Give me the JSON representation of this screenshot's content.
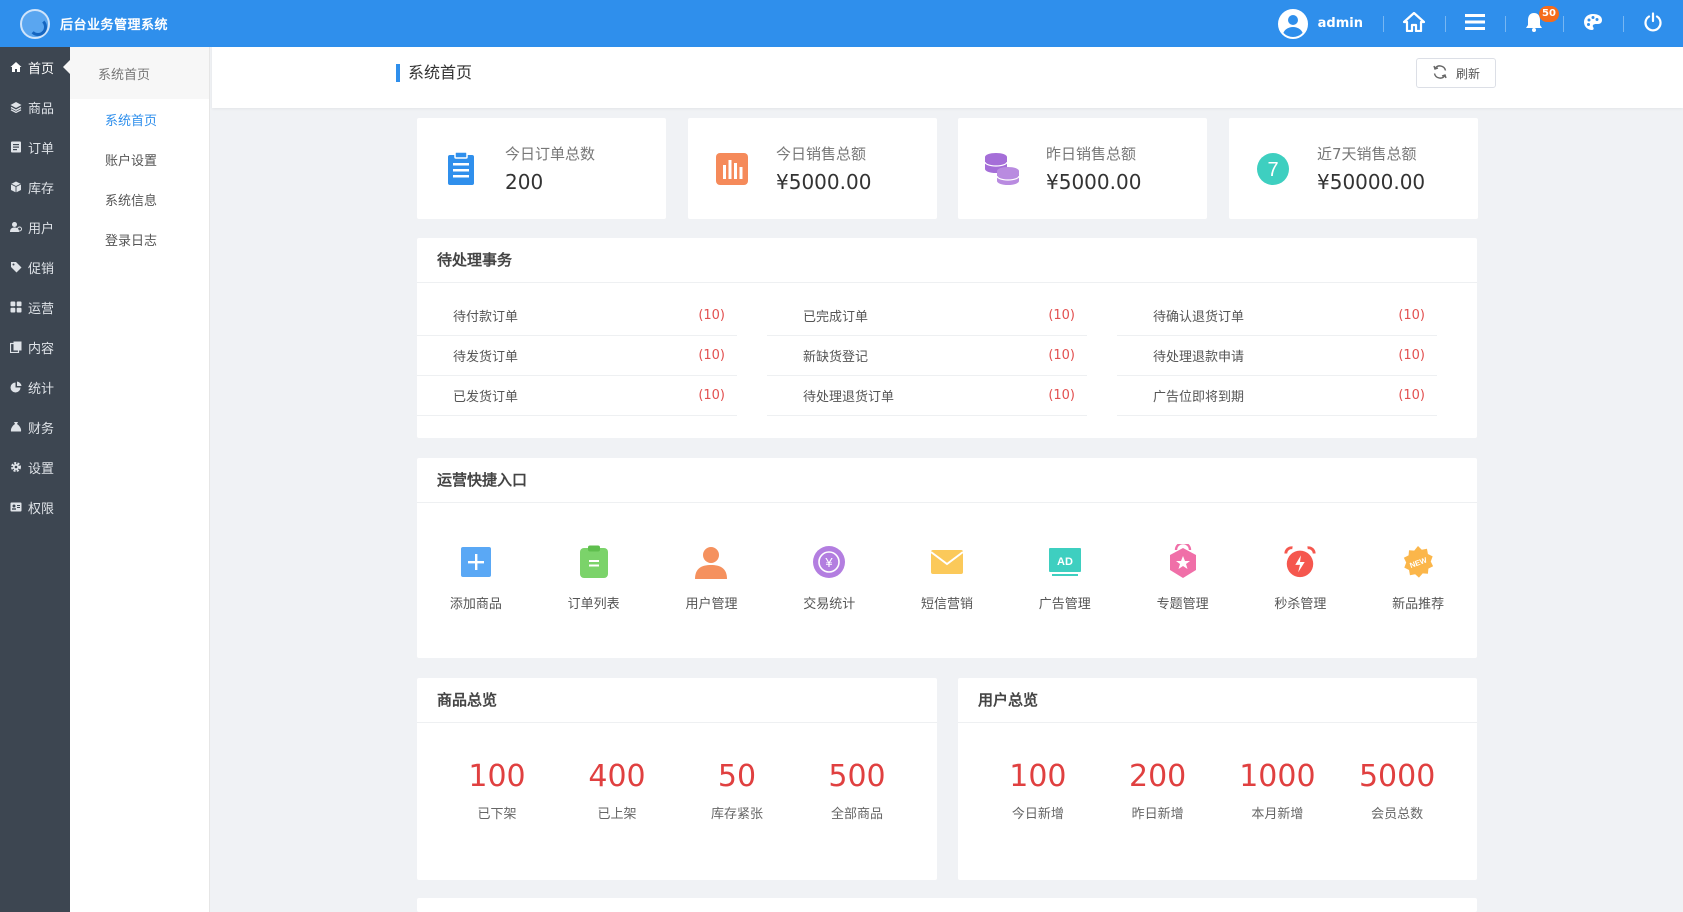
{
  "app": {
    "title": "后台业务管理系统"
  },
  "topbar": {
    "username": "admin",
    "notification_count": "50"
  },
  "sidebar": {
    "items": [
      {
        "label": "首页",
        "icon": "home-icon"
      },
      {
        "label": "商品",
        "icon": "layers-icon"
      },
      {
        "label": "订单",
        "icon": "order-icon"
      },
      {
        "label": "库存",
        "icon": "box-icon"
      },
      {
        "label": "用户",
        "icon": "users-icon"
      },
      {
        "label": "促销",
        "icon": "tag-icon"
      },
      {
        "label": "运营",
        "icon": "grid-icon"
      },
      {
        "label": "内容",
        "icon": "copy-icon"
      },
      {
        "label": "统计",
        "icon": "pie-icon"
      },
      {
        "label": "财务",
        "icon": "money-bag-icon"
      },
      {
        "label": "设置",
        "icon": "gear-icon"
      },
      {
        "label": "权限",
        "icon": "id-card-icon"
      }
    ]
  },
  "submenu": {
    "header": "系统首页",
    "items": [
      {
        "label": "系统首页"
      },
      {
        "label": "账户设置"
      },
      {
        "label": "系统信息"
      },
      {
        "label": "登录日志"
      }
    ]
  },
  "page": {
    "title": "系统首页",
    "refresh_label": "刷新"
  },
  "stats": [
    {
      "label": "今日订单总数",
      "value": "200",
      "icon": "clipboard-icon",
      "color": "#2f8fec"
    },
    {
      "label": "今日销售总额",
      "value": "¥5000.00",
      "icon": "bar-chart-icon",
      "color": "#f58a5a"
    },
    {
      "label": "昨日销售总额",
      "value": "¥5000.00",
      "icon": "coins-icon",
      "color": "#a56ed8"
    },
    {
      "label": "近7天销售总额",
      "value": "¥50000.00",
      "icon": "seven-days-icon",
      "color": "#3ecfc0"
    }
  ],
  "todo": {
    "title": "待处理事务",
    "columns": [
      [
        {
          "label": "待付款订单",
          "count": "(10)"
        },
        {
          "label": "待发货订单",
          "count": "(10)"
        },
        {
          "label": "已发货订单",
          "count": "(10)"
        }
      ],
      [
        {
          "label": "已完成订单",
          "count": "(10)"
        },
        {
          "label": "新缺货登记",
          "count": "(10)"
        },
        {
          "label": "待处理退货订单",
          "count": "(10)"
        }
      ],
      [
        {
          "label": "待确认退货订单",
          "count": "(10)"
        },
        {
          "label": "待处理退款申请",
          "count": "(10)"
        },
        {
          "label": "广告位即将到期",
          "count": "(10)"
        }
      ]
    ]
  },
  "quick": {
    "title": "运营快捷入口",
    "items": [
      {
        "label": "添加商品",
        "icon": "add-icon"
      },
      {
        "label": "订单列表",
        "icon": "clipboard-list-icon"
      },
      {
        "label": "用户管理",
        "icon": "user-icon"
      },
      {
        "label": "交易统计",
        "icon": "yen-icon"
      },
      {
        "label": "短信营销",
        "icon": "envelope-icon"
      },
      {
        "label": "广告管理",
        "icon": "ad-icon",
        "text": "AD"
      },
      {
        "label": "专题管理",
        "icon": "star-bag-icon"
      },
      {
        "label": "秒杀管理",
        "icon": "alarm-clock-icon"
      },
      {
        "label": "新品推荐",
        "icon": "new-badge-icon",
        "text": "NEW"
      }
    ]
  },
  "products": {
    "title": "商品总览",
    "items": [
      {
        "value": "100",
        "label": "已下架"
      },
      {
        "value": "400",
        "label": "已上架"
      },
      {
        "value": "50",
        "label": "库存紧张"
      },
      {
        "value": "500",
        "label": "全部商品"
      }
    ]
  },
  "users": {
    "title": "用户总览",
    "items": [
      {
        "value": "100",
        "label": "今日新增"
      },
      {
        "value": "200",
        "label": "昨日新增"
      },
      {
        "value": "1000",
        "label": "本月新增"
      },
      {
        "value": "5000",
        "label": "会员总数"
      }
    ]
  }
}
